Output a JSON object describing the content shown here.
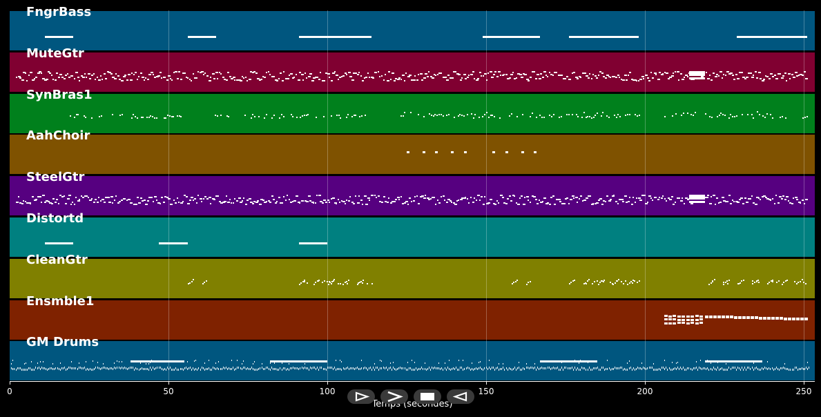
{
  "axis": {
    "label": "Temps (secondes)",
    "ticks": [
      "0",
      "50",
      "100",
      "150",
      "200",
      "250"
    ],
    "tick_values": [
      0,
      50,
      100,
      150,
      200,
      250
    ],
    "range": [
      0,
      253
    ]
  },
  "tracks": [
    {
      "name": "FngrBass",
      "color": "#00567f",
      "pattern": "blocks",
      "segments": [
        [
          11,
          20
        ],
        [
          56,
          65
        ],
        [
          91,
          114
        ],
        [
          149,
          167
        ],
        [
          176,
          198
        ],
        [
          229,
          251
        ]
      ]
    },
    {
      "name": "MuteGtr",
      "color": "#800031",
      "pattern": "dense",
      "segments": [
        [
          2,
          218
        ],
        [
          218,
          251
        ]
      ],
      "highlight": [
        [
          214,
          219
        ]
      ]
    },
    {
      "name": "SynBras1",
      "color": "#00801c",
      "pattern": "sparse",
      "segments": [
        [
          19,
          54
        ],
        [
          64,
          70
        ],
        [
          74,
          114
        ],
        [
          123,
          198
        ],
        [
          206,
          216
        ],
        [
          219,
          251
        ]
      ]
    },
    {
      "name": "AahChoir",
      "color": "#7f5200",
      "pattern": "dots",
      "points": [
        125,
        130,
        134,
        139,
        143,
        152,
        156,
        161,
        165
      ]
    },
    {
      "name": "SteelGtr",
      "color": "#560080",
      "pattern": "dense",
      "segments": [
        [
          2,
          218
        ],
        [
          218,
          251
        ]
      ],
      "highlight": [
        [
          214,
          219
        ]
      ]
    },
    {
      "name": "Distortd",
      "color": "#008080",
      "pattern": "blocks",
      "segments": [
        [
          11,
          20
        ],
        [
          47,
          56
        ],
        [
          91,
          100
        ]
      ]
    },
    {
      "name": "CleanGtr",
      "color": "#808000",
      "pattern": "phrases",
      "segments": [
        [
          56,
          62
        ],
        [
          91,
          114
        ],
        [
          158,
          164
        ],
        [
          176,
          198
        ],
        [
          220,
          251
        ]
      ]
    },
    {
      "name": "Ensmble1",
      "color": "#7f2200",
      "pattern": "chords",
      "segments": [
        [
          206,
          218
        ],
        [
          219,
          251
        ]
      ]
    },
    {
      "name": "GM Drums",
      "color": "#00567f",
      "pattern": "drums",
      "segments": [
        [
          0,
          253
        ]
      ],
      "highlight": [
        [
          38,
          55
        ],
        [
          82,
          100
        ],
        [
          167,
          185
        ],
        [
          219,
          237
        ]
      ]
    }
  ],
  "controls": [
    {
      "name": "play-button",
      "icon": "play-icon"
    },
    {
      "name": "forward-button",
      "icon": "forward-icon"
    },
    {
      "name": "stop-button",
      "icon": "stop-icon"
    },
    {
      "name": "rewind-button",
      "icon": "rewind-icon"
    }
  ]
}
